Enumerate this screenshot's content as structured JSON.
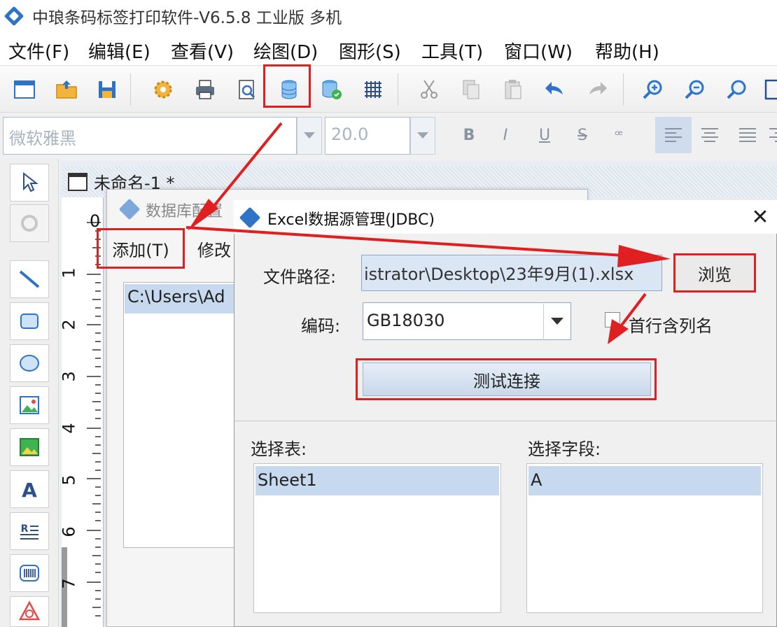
{
  "window": {
    "title": "中琅条码标签打印软件-V6.5.8 工业版 多机"
  },
  "menu": {
    "items": [
      {
        "label": "文件(F)"
      },
      {
        "label": "编辑(E)"
      },
      {
        "label": "查看(V)"
      },
      {
        "label": "绘图(D)"
      },
      {
        "label": "图形(S)"
      },
      {
        "label": "工具(T)"
      },
      {
        "label": "窗口(W)"
      },
      {
        "label": "帮助(H)"
      }
    ]
  },
  "toolbar": {
    "icons": [
      "new-document-icon",
      "open-folder-icon",
      "save-icon",
      "settings-gear-icon",
      "print-icon",
      "print-preview-icon",
      "database-icon",
      "database-settings-icon",
      "grid-icon",
      "cut-icon",
      "copy-icon",
      "paste-icon",
      "undo-icon",
      "redo-icon",
      "zoom-in-icon",
      "zoom-out-icon",
      "zoom-fit-icon"
    ],
    "highlighted": "database-icon"
  },
  "fontbar": {
    "font_name": "微软雅黑",
    "font_size": "20.0",
    "bold": "B",
    "italic": "I",
    "underline": "U",
    "strike": "S",
    "special": "ꟹ"
  },
  "document": {
    "tab_title": "未命名-1 *"
  },
  "ruler": {
    "marks": [
      "0",
      "1",
      "2",
      "3",
      "4",
      "5",
      "6",
      "7"
    ]
  },
  "db_config_dialog": {
    "title": "数据库配置",
    "add_label": "添加(T)",
    "modify_label": "修改",
    "list_item": "C:\\Users\\Ad"
  },
  "excel_dialog": {
    "title": "Excel数据源管理(JDBC)",
    "close": "✕",
    "file_path_label": "文件路径:",
    "file_path_value": "istrator\\Desktop\\23年9月(1).xlsx",
    "browse_label": "浏览",
    "encoding_label": "编码:",
    "encoding_value": "GB18030",
    "first_row_header_label": "首行含列名",
    "first_row_header_checked": false,
    "test_connection_label": "测试连接",
    "select_table_label": "选择表:",
    "select_field_label": "选择字段:",
    "tables": [
      "Sheet1"
    ],
    "fields": [
      "A"
    ]
  },
  "colors": {
    "annotation_red": "#e02020",
    "selection_blue": "#c7d9ee",
    "accent_blue": "#2f73c9"
  }
}
